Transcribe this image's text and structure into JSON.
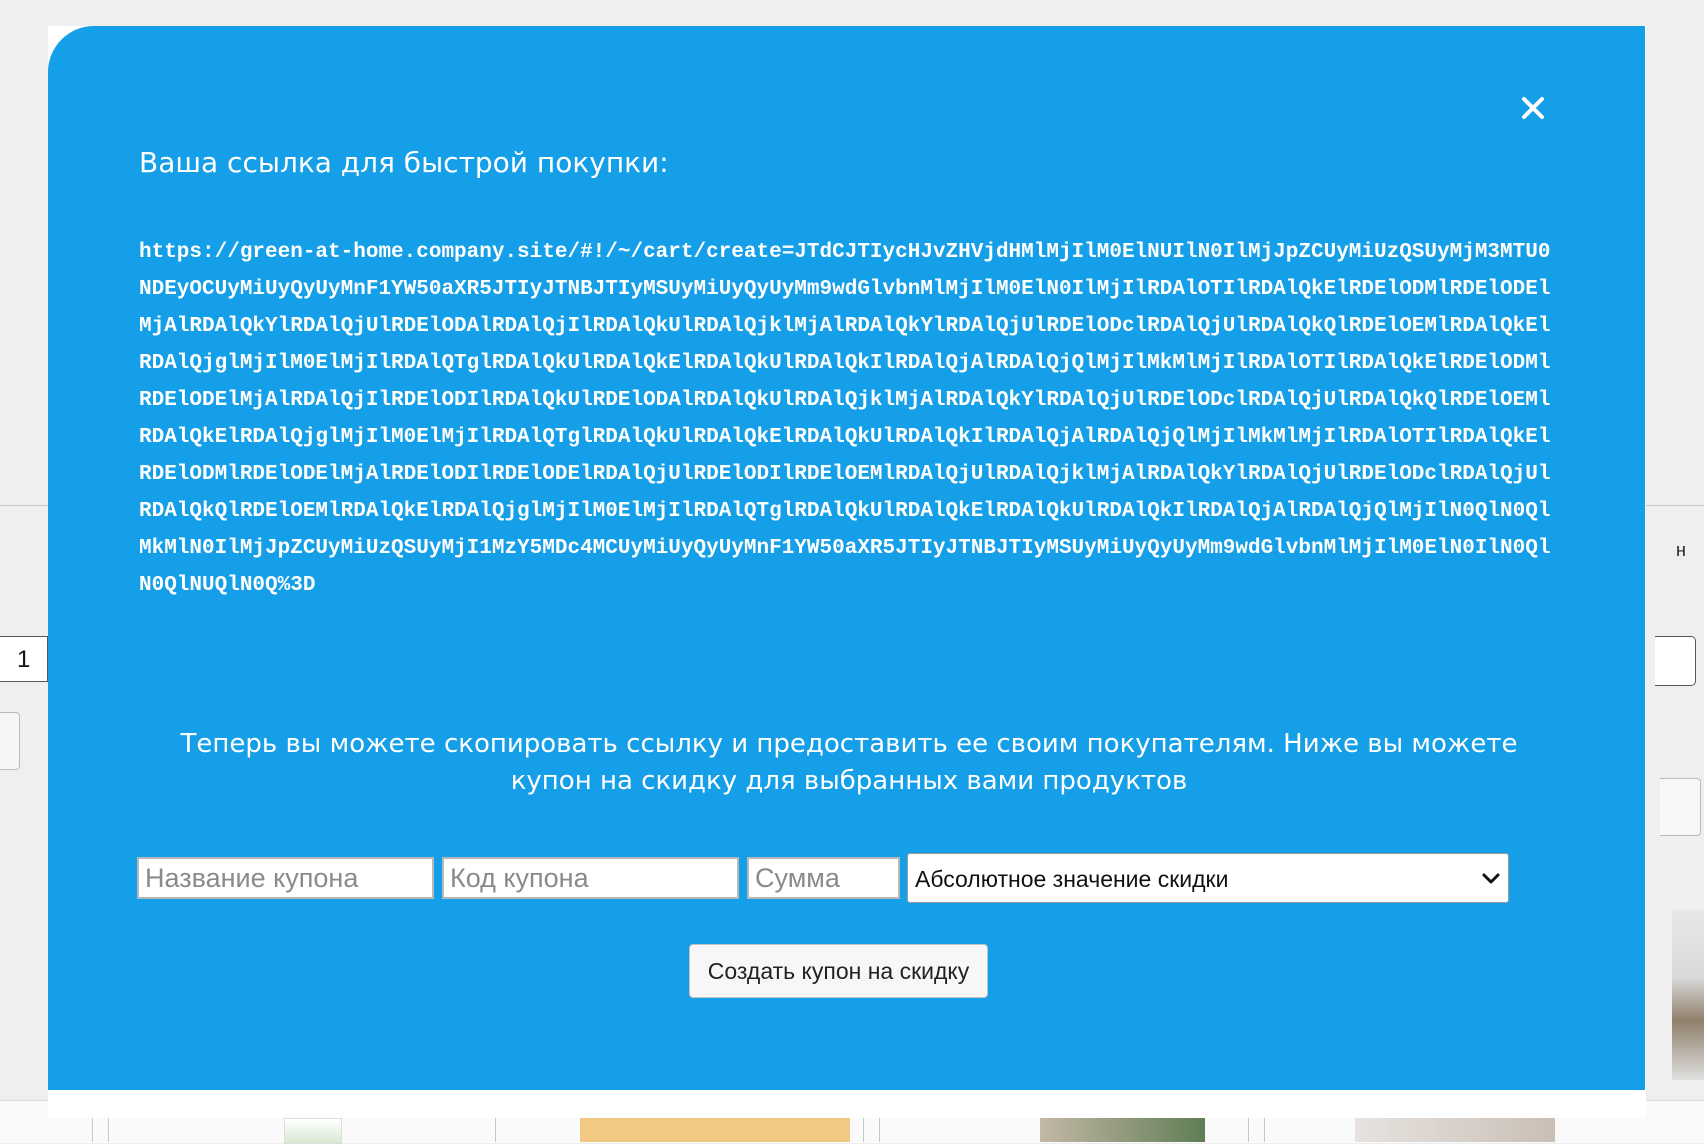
{
  "background": {
    "quantity_value": "1",
    "right_edge_glyph": "н"
  },
  "modal": {
    "title": "Ваша ссылка для быстрой покупки:",
    "close_icon": "close-icon",
    "link": "https://green-at-home.company.site/#!/~/cart/create=JTdCJTIycHJvZHVjdHMlMjIlM0ElNUIlN0IlMjJpZCUyMiUzQSUyMjM3MTU0NDEyOCUyMiUyQyUyMnF1YW50aXR5JTIyJTNBJTIyMSUyMiUyQyUyMm9wdGlvbnMlMjIlM0ElN0IlMjIlRDAlOTIlRDAlQkElRDElODMlRDElODElMjAlRDAlQkYlRDAlQjUlRDElODAlRDAlQjIlRDAlQkUlRDAlQjklMjAlRDAlQkYlRDAlQjUlRDElODclRDAlQjUlRDAlQkQlRDElOEMlRDAlQkElRDAlQjglMjIlM0ElMjIlRDAlQTglRDAlQkUlRDAlQkElRDAlQkUlRDAlQkIlRDAlQjAlRDAlQjQlMjIlMkMlMjIlRDAlOTIlRDAlQkElRDElODMlRDElODElMjAlRDAlQjIlRDElODIlRDAlQkUlRDElODAlRDAlQkUlRDAlQjklMjAlRDAlQkYlRDAlQjUlRDElODclRDAlQjUlRDAlQkQlRDElOEMlRDAlQkElRDAlQjglMjIlM0ElMjIlRDAlQTglRDAlQkUlRDAlQkElRDAlQkUlRDAlQkIlRDAlQjAlRDAlQjQlMjIlMkMlMjIlRDAlOTIlRDAlQkElRDElODMlRDElODElMjAlRDElODIlRDElODElRDAlQjUlRDElODIlRDElOEMlRDAlQjUlRDAlQjklMjAlRDAlQkYlRDAlQjUlRDElODclRDAlQjUlRDAlQkQlRDElOEMlRDAlQkElRDAlQjglMjIlM0ElMjIlRDAlQTglRDAlQkUlRDAlQkElRDAlQkUlRDAlQkIlRDAlQjAlRDAlQjQlMjIlN0QlN0QlMkMlN0IlMjJpZCUyMiUzQSUyMjI1MzY5MDc4MCUyMiUyQyUyMnF1YW50aXR5JTIyJTNBJTIyMSUyMiUyQyUyMm9wdGlvbnMlMjIlM0ElN0IlN0QlN0QlNUQlN0Q%3D",
    "info": "Теперь вы можете скопировать ссылку и предоставить ее своим покупателям. Ниже вы можете купон на скидку для выбранных вами продуктов",
    "coupon_form": {
      "name_placeholder": "Название купона",
      "code_placeholder": "Код купона",
      "sum_placeholder": "Сумма",
      "discount_type_selected": "Абсолютное значение скидки",
      "submit_label": "Создать купон на скидку"
    }
  },
  "colors": {
    "modal_background": "#149fe8",
    "modal_text": "#ffffff",
    "button_background": "#f7f7f7"
  }
}
